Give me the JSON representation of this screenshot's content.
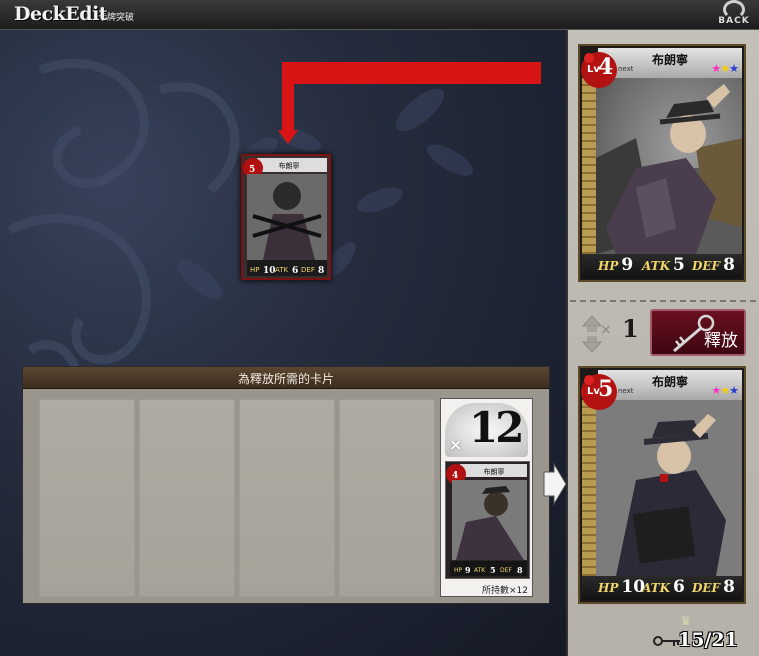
{
  "header": {
    "title": "DeckEdit",
    "subtitle": "卡牌突破",
    "back_label": "BACK"
  },
  "release_panel": {
    "title": "為釋放所需的卡片",
    "owned_count": "12",
    "owned_times": "×",
    "owned_label": "所持數×12",
    "empty_slots": 4
  },
  "small_card": {
    "name": "布朗寧",
    "level": "5",
    "hp": "10",
    "atk": "6",
    "def": "8"
  },
  "current_card": {
    "name": "布朗寧",
    "lv_label": "Lv",
    "level": "4",
    "next_label": "next",
    "stars": "★★★",
    "hp_label": "HP",
    "hp": "9",
    "atk_label": "ATK",
    "atk": "5",
    "def_label": "DEF",
    "def": "8"
  },
  "release_control": {
    "times": "×",
    "quantity": "1",
    "button_label": "釋放"
  },
  "result_card": {
    "name": "布朗寧",
    "lv_label": "Lv",
    "level": "5",
    "next_label": "next",
    "stars": "★★★",
    "hp_label": "HP",
    "hp": "10",
    "atk_label": "ATK",
    "atk": "6",
    "def_label": "DEF",
    "def": "8"
  },
  "deck": {
    "count": "15/21"
  },
  "colors": {
    "accent_red": "#d81414",
    "release_button": "#6b1020",
    "stat_gold": "#f0d56a"
  }
}
